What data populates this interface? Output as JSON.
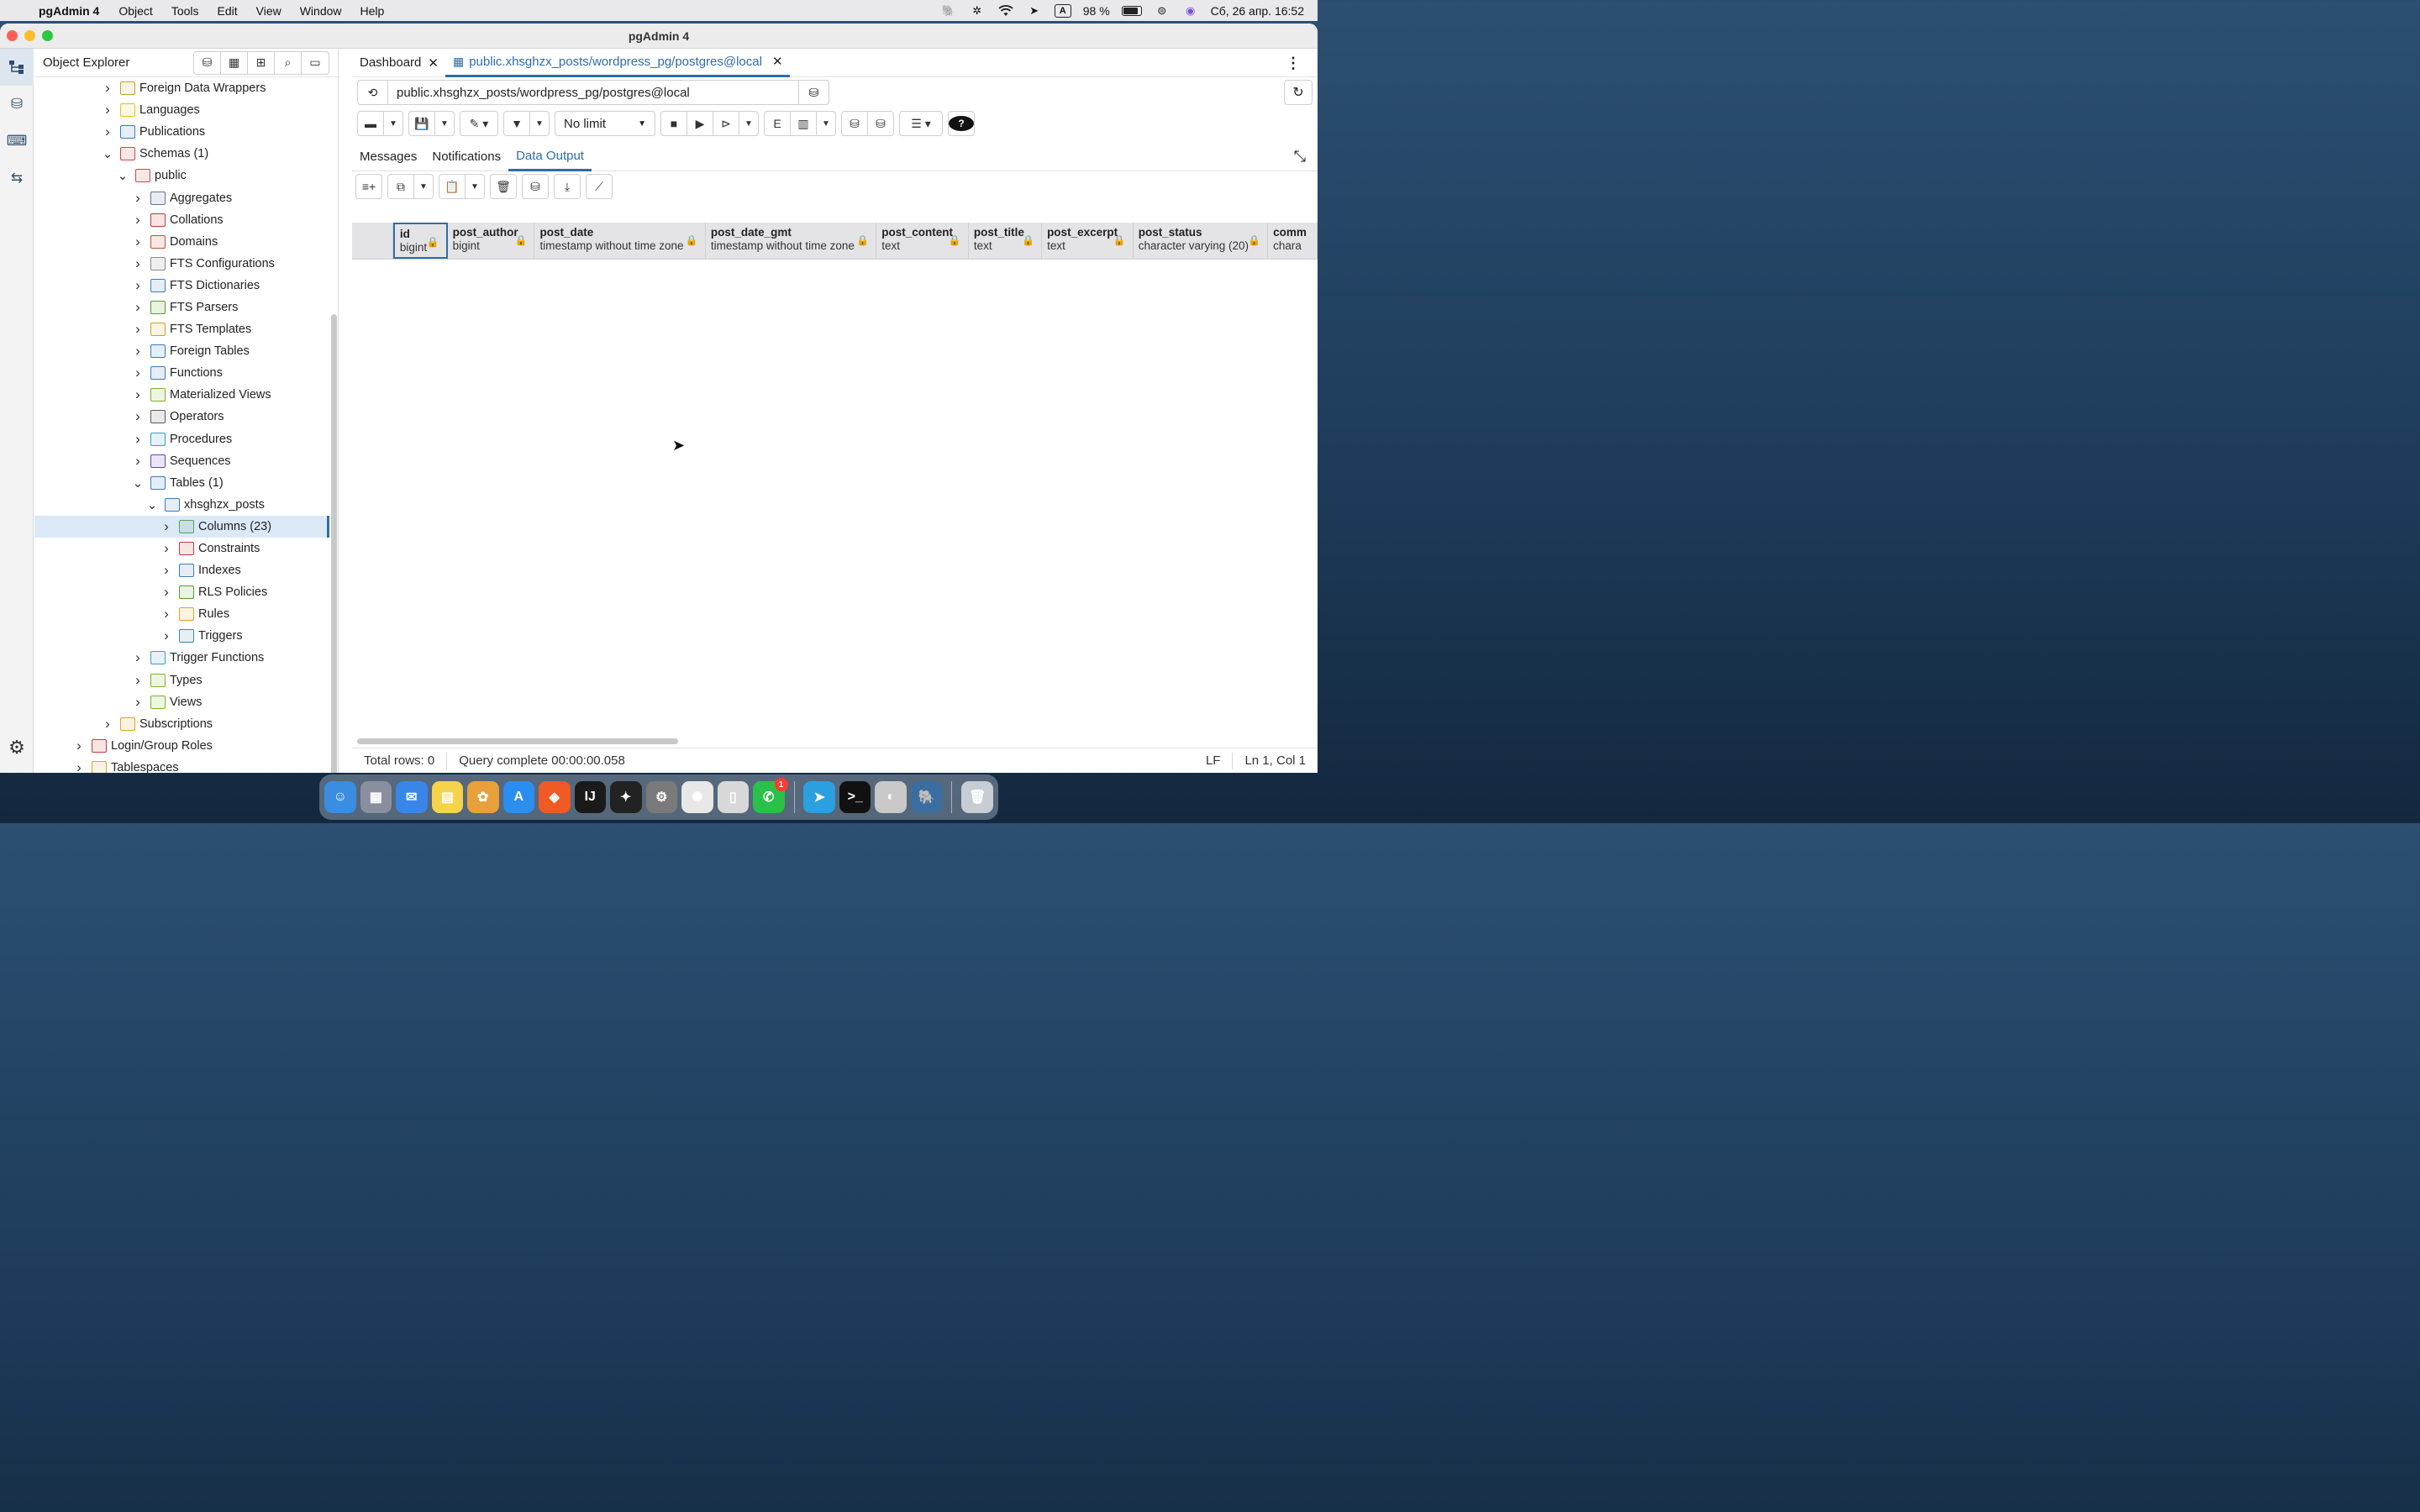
{
  "menubar": {
    "app_name": "pgAdmin 4",
    "items": [
      "Object",
      "Tools",
      "Edit",
      "View",
      "Window",
      "Help"
    ],
    "input_lang": "A",
    "battery": "98 %",
    "datetime": "Сб, 26 апр.  16:52"
  },
  "window": {
    "title": "pgAdmin 4"
  },
  "explorer": {
    "title": "Object Explorer",
    "tree": [
      {
        "label": "Foreign Data Wrappers",
        "indent": 1,
        "state": "collapsed",
        "icon": "fdw-icon",
        "color": "#c9a227"
      },
      {
        "label": "Languages",
        "indent": 1,
        "state": "collapsed",
        "icon": "language-icon",
        "color": "#e0c31f"
      },
      {
        "label": "Publications",
        "indent": 1,
        "state": "collapsed",
        "icon": "publication-icon",
        "color": "#3b7bbf"
      },
      {
        "label": "Schemas (1)",
        "indent": 1,
        "state": "expanded",
        "icon": "schemas-icon",
        "color": "#d64545"
      },
      {
        "label": "public",
        "indent": 2,
        "state": "expanded",
        "icon": "schema-icon",
        "color": "#d64545"
      },
      {
        "label": "Aggregates",
        "indent": 3,
        "state": "collapsed",
        "icon": "aggregate-icon",
        "color": "#5a7a99"
      },
      {
        "label": "Collations",
        "indent": 3,
        "state": "collapsed",
        "icon": "collation-icon",
        "color": "#c23b3b"
      },
      {
        "label": "Domains",
        "indent": 3,
        "state": "collapsed",
        "icon": "domain-icon",
        "color": "#b5553a"
      },
      {
        "label": "FTS Configurations",
        "indent": 3,
        "state": "collapsed",
        "icon": "fts-config-icon",
        "color": "#8a8a8a"
      },
      {
        "label": "FTS Dictionaries",
        "indent": 3,
        "state": "collapsed",
        "icon": "fts-dictionary-icon",
        "color": "#3b7bbf"
      },
      {
        "label": "FTS Parsers",
        "indent": 3,
        "state": "collapsed",
        "icon": "fts-parser-icon",
        "color": "#5a9a2a"
      },
      {
        "label": "FTS Templates",
        "indent": 3,
        "state": "collapsed",
        "icon": "fts-template-icon",
        "color": "#c9a227"
      },
      {
        "label": "Foreign Tables",
        "indent": 3,
        "state": "collapsed",
        "icon": "foreign-table-icon",
        "color": "#3b7bbf"
      },
      {
        "label": "Functions",
        "indent": 3,
        "state": "collapsed",
        "icon": "function-icon",
        "color": "#3b7bbf"
      },
      {
        "label": "Materialized Views",
        "indent": 3,
        "state": "collapsed",
        "icon": "materialized-view-icon",
        "color": "#7ab32a"
      },
      {
        "label": "Operators",
        "indent": 3,
        "state": "collapsed",
        "icon": "operator-icon",
        "color": "#5a5a5a"
      },
      {
        "label": "Procedures",
        "indent": 3,
        "state": "collapsed",
        "icon": "procedure-icon",
        "color": "#3b9bbf"
      },
      {
        "label": "Sequences",
        "indent": 3,
        "state": "collapsed",
        "icon": "sequence-icon",
        "color": "#6a3fbf"
      },
      {
        "label": "Tables (1)",
        "indent": 3,
        "state": "expanded",
        "icon": "tables-icon",
        "color": "#3b7bbf"
      },
      {
        "label": "xhsghzx_posts",
        "indent": 4,
        "state": "expanded",
        "icon": "table-icon",
        "color": "#3b7bbf"
      },
      {
        "label": "Columns (23)",
        "indent": 5,
        "state": "collapsed",
        "icon": "columns-icon",
        "color": "#5aa05a",
        "selected": true
      },
      {
        "label": "Constraints",
        "indent": 5,
        "state": "collapsed",
        "icon": "constraint-icon",
        "color": "#c23b3b"
      },
      {
        "label": "Indexes",
        "indent": 5,
        "state": "collapsed",
        "icon": "index-icon",
        "color": "#3b7bbf"
      },
      {
        "label": "RLS Policies",
        "indent": 5,
        "state": "collapsed",
        "icon": "rls-policy-icon",
        "color": "#5a9a2a"
      },
      {
        "label": "Rules",
        "indent": 5,
        "state": "collapsed",
        "icon": "rule-icon",
        "color": "#e0a31f"
      },
      {
        "label": "Triggers",
        "indent": 5,
        "state": "collapsed",
        "icon": "trigger-icon",
        "color": "#3b8b9b"
      },
      {
        "label": "Trigger Functions",
        "indent": 3,
        "state": "collapsed",
        "icon": "trigger-function-icon",
        "color": "#3b9bbf"
      },
      {
        "label": "Types",
        "indent": 3,
        "state": "collapsed",
        "icon": "type-icon",
        "color": "#7ab32a"
      },
      {
        "label": "Views",
        "indent": 3,
        "state": "collapsed",
        "icon": "view-icon",
        "color": "#7ab32a"
      },
      {
        "label": "Subscriptions",
        "indent": 1,
        "state": "collapsed",
        "icon": "subscription-icon",
        "color": "#e0a31f"
      },
      {
        "label": "Login/Group Roles",
        "indent": 0,
        "state": "collapsed",
        "icon": "login-role-icon",
        "color": "#c23b3b"
      },
      {
        "label": "Tablespaces",
        "indent": 0,
        "state": "collapsed",
        "icon": "tablespace-icon",
        "color": "#e0a31f"
      }
    ]
  },
  "tabs": [
    {
      "label": "Dashboard",
      "active": false
    },
    {
      "label": "public.xhsghzx_posts/wordpress_pg/postgres@local",
      "active": true
    }
  ],
  "connection": {
    "label": "public.xhsghzx_posts/wordpress_pg/postgres@local"
  },
  "toolbar": {
    "limit": "No limit"
  },
  "result_tabs": [
    {
      "label": "Messages",
      "active": false
    },
    {
      "label": "Notifications",
      "active": false
    },
    {
      "label": "Data Output",
      "active": true
    }
  ],
  "columns": [
    {
      "name": "id",
      "type": "bigint"
    },
    {
      "name": "post_author",
      "type": "bigint"
    },
    {
      "name": "post_date",
      "type": "timestamp without time zone"
    },
    {
      "name": "post_date_gmt",
      "type": "timestamp without time zone"
    },
    {
      "name": "post_content",
      "type": "text"
    },
    {
      "name": "post_title",
      "type": "text"
    },
    {
      "name": "post_excerpt",
      "type": "text"
    },
    {
      "name": "post_status",
      "type": "character varying (20)"
    },
    {
      "name": "comm",
      "type": "chara"
    }
  ],
  "status": {
    "total_rows": "Total rows: 0",
    "query": "Query complete 00:00:00.058",
    "line_ending": "LF",
    "position": "Ln 1, Col 1"
  },
  "dock": {
    "apps": [
      {
        "name": "finder",
        "glyph": "☺",
        "color": "#3a8de0"
      },
      {
        "name": "launchpad",
        "glyph": "▦",
        "color": "#8a8fa0"
      },
      {
        "name": "mail",
        "glyph": "✉",
        "color": "#3a86e8"
      },
      {
        "name": "notes",
        "glyph": "▤",
        "color": "#f5d34a"
      },
      {
        "name": "photos",
        "glyph": "✿",
        "color": "#e8a03a"
      },
      {
        "name": "app-store",
        "glyph": "A",
        "color": "#2a8ef0"
      },
      {
        "name": "brave",
        "glyph": "◈",
        "color": "#f05a24"
      },
      {
        "name": "intellij",
        "glyph": "IJ",
        "color": "#1a1a1a"
      },
      {
        "name": "figma",
        "glyph": "✦",
        "color": "#222"
      },
      {
        "name": "system-settings",
        "glyph": "⚙",
        "color": "#7a7a7a"
      },
      {
        "name": "chatgpt",
        "glyph": "✺",
        "color": "#e8e8e8"
      },
      {
        "name": "iphone-mirroring",
        "glyph": "▯",
        "color": "#d8d8d8"
      },
      {
        "name": "whatsapp",
        "glyph": "✆",
        "color": "#2ac04a",
        "badge": "1"
      },
      {
        "name": "telegram",
        "glyph": "➤",
        "color": "#2aa0e0"
      },
      {
        "name": "terminal",
        "glyph": ">_",
        "color": "#111"
      },
      {
        "name": "sequel",
        "glyph": "◐",
        "color": "#c8c8c8"
      },
      {
        "name": "pgadmin",
        "glyph": "🐘",
        "color": "#3a6ea0"
      },
      {
        "name": "trash",
        "glyph": "🗑",
        "color": "#c8ccd4"
      }
    ]
  }
}
